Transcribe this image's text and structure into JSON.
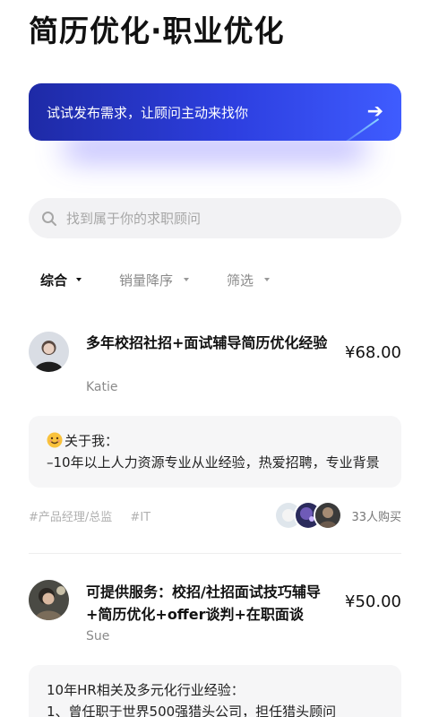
{
  "page": {
    "title": "简历优化·职业优化"
  },
  "banner": {
    "text": "试试发布需求，让顾问主动来找你",
    "arrow_icon": "arrow-right-icon"
  },
  "search": {
    "placeholder": "找到属于你的求职顾问",
    "icon": "search-icon"
  },
  "filters": [
    {
      "label": "综合",
      "active": true
    },
    {
      "label": "销量降序",
      "active": false
    },
    {
      "label": "筛选",
      "active": false
    }
  ],
  "listings": [
    {
      "title": "多年校招社招+面试辅导简历优化经验",
      "price": "¥68.00",
      "author": "Katie",
      "about_heading": "关于我：",
      "about_text": "–10年以上人力资源专业从业经验，热爱招聘，专业背景",
      "tags": [
        "#产品经理/总监",
        "#IT"
      ],
      "buy_count": "33人购买"
    },
    {
      "title": "可提供服务：校招/社招面试技巧辅导+简历优化+offer谈判+在职面谈",
      "price": "¥50.00",
      "author": "Sue",
      "about_line1": "10年HR相关及多元化行业经验：",
      "about_line2": "1、曾任职于世界500强猎头公司，担任猎头顾问"
    }
  ],
  "colors": {
    "accent": "#2d3fe0",
    "text": "#111111",
    "muted": "#8a8a8a",
    "surface": "#f2f2f4"
  }
}
